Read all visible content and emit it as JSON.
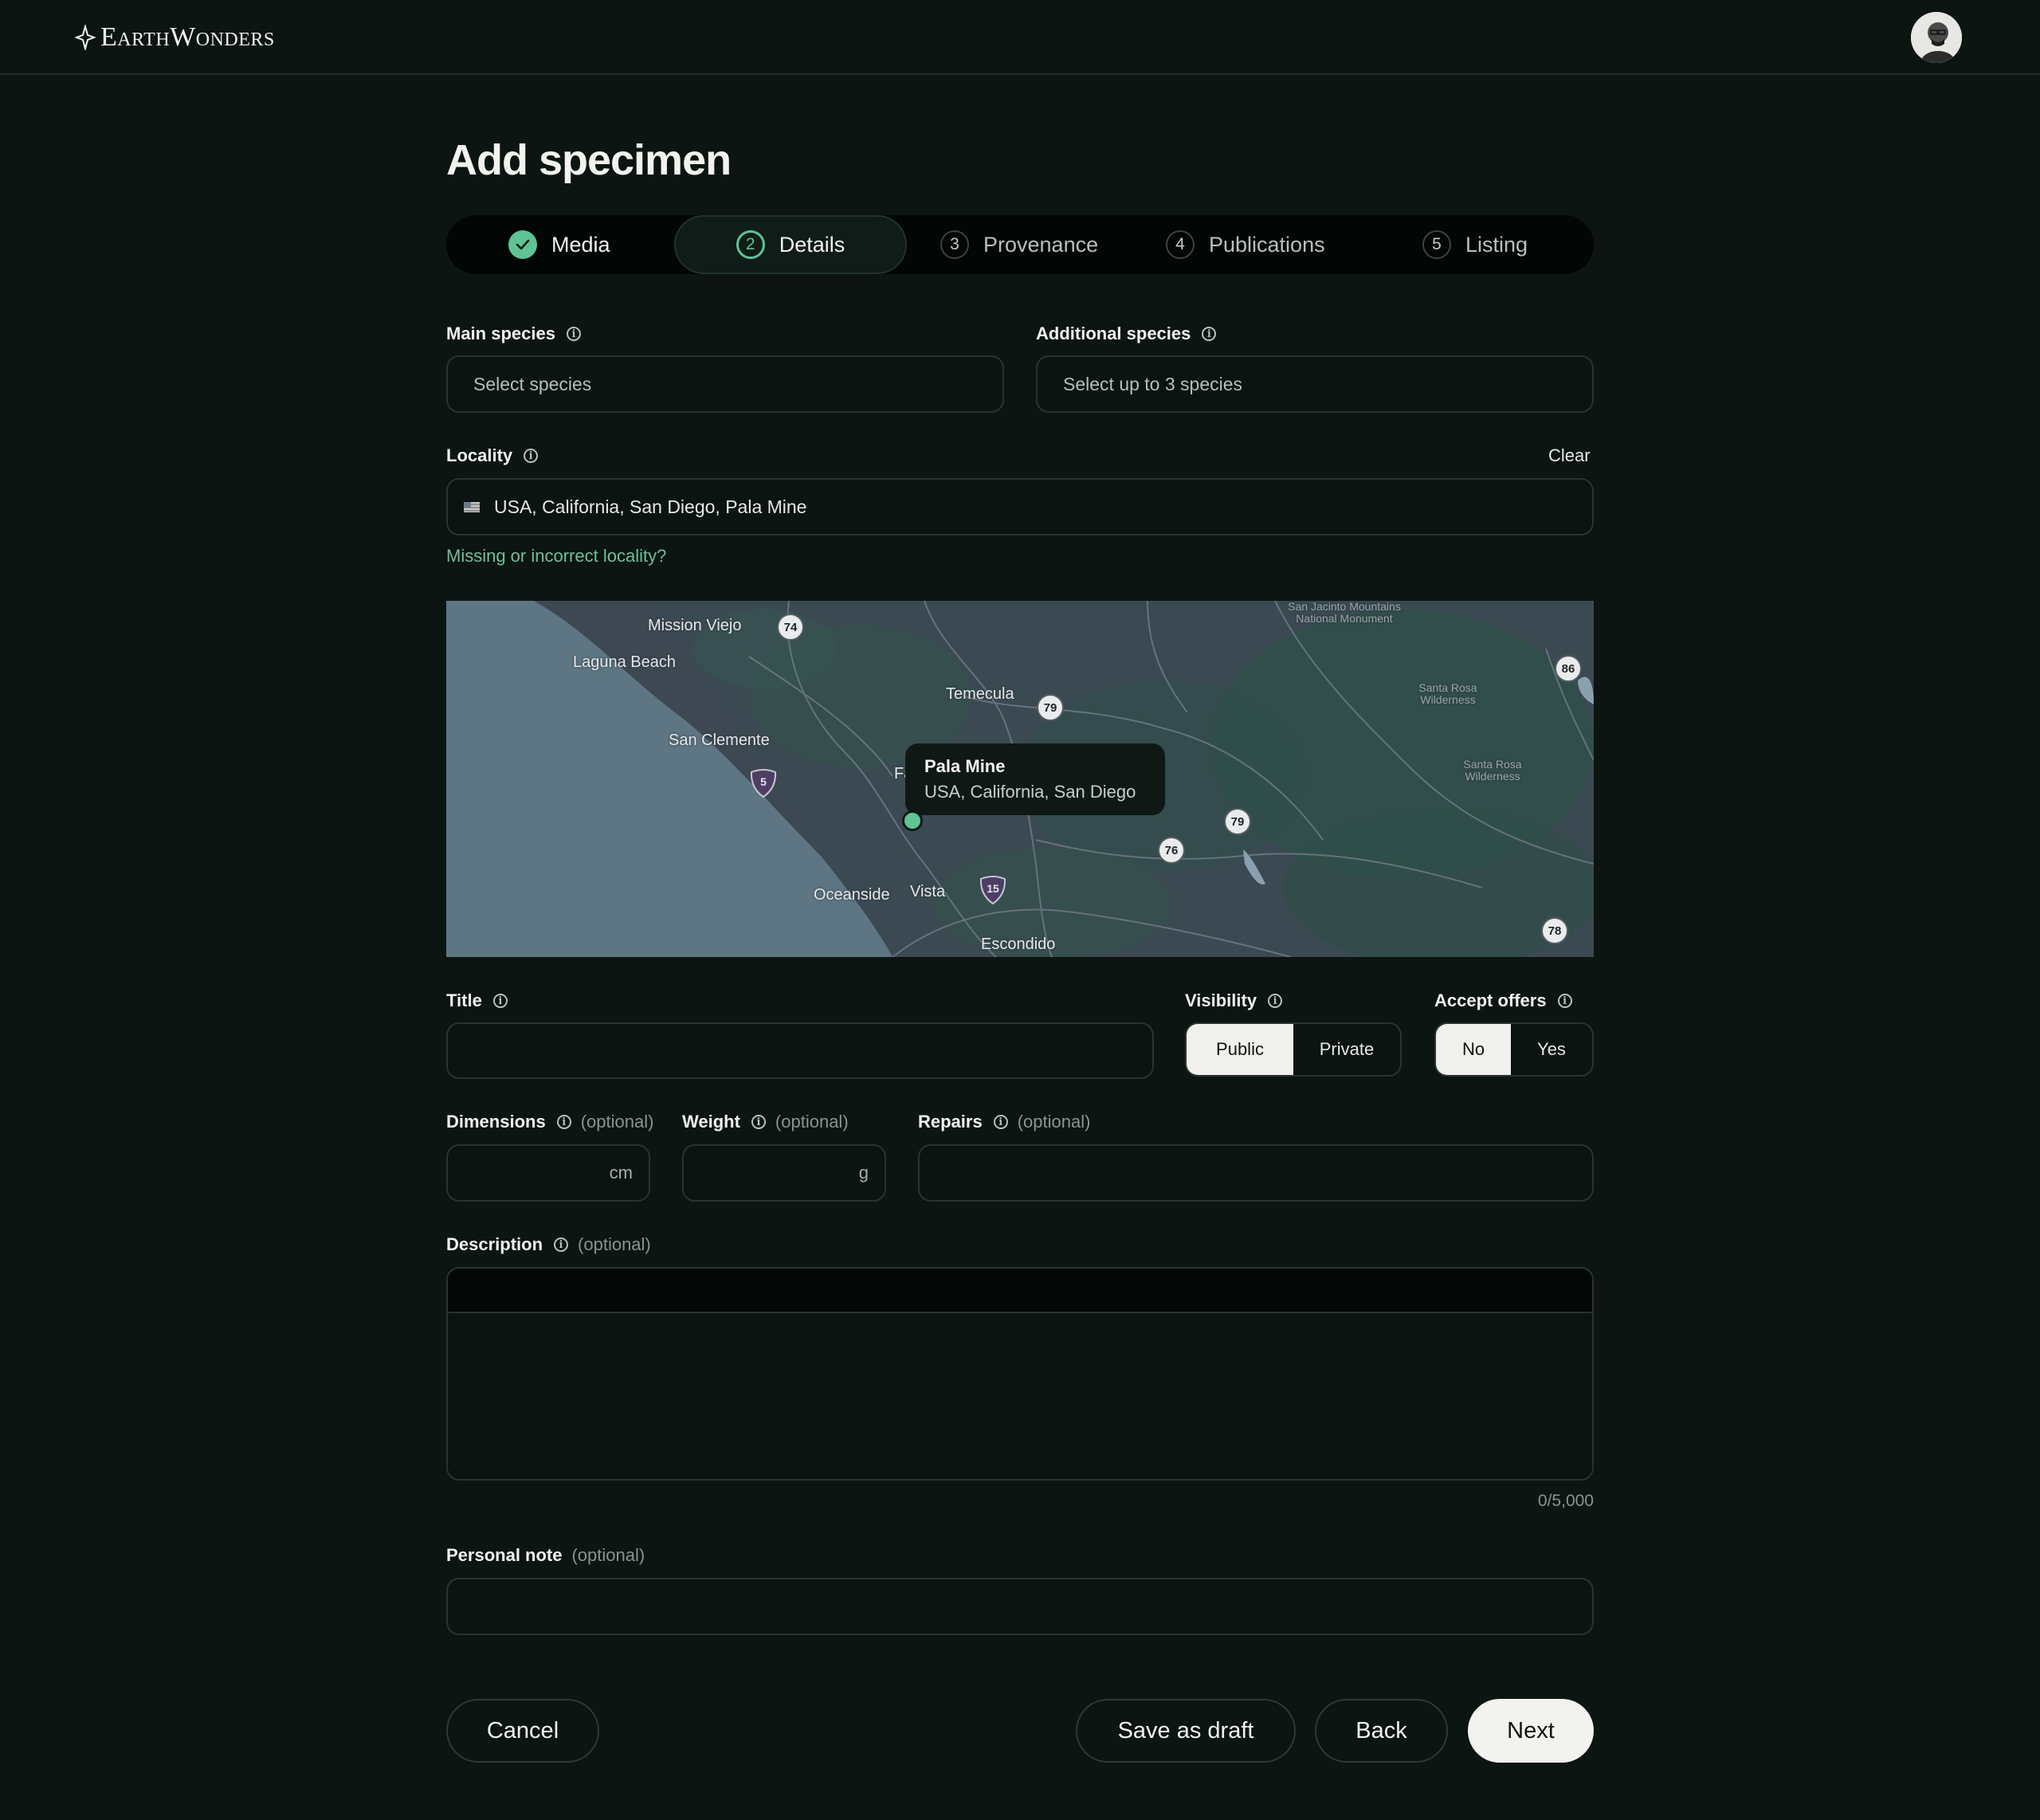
{
  "header": {
    "logo_text": "EarthWonders",
    "avatar_alt": "User avatar"
  },
  "page": {
    "title": "Add specimen"
  },
  "stepper": {
    "steps": [
      {
        "number": "",
        "label": "Media",
        "state": "done"
      },
      {
        "number": "2",
        "label": "Details",
        "state": "active"
      },
      {
        "number": "3",
        "label": "Provenance",
        "state": "upcoming"
      },
      {
        "number": "4",
        "label": "Publications",
        "state": "upcoming"
      },
      {
        "number": "5",
        "label": "Listing",
        "state": "upcoming"
      }
    ]
  },
  "form": {
    "main_species": {
      "label": "Main species",
      "placeholder": "Select species"
    },
    "additional_species": {
      "label": "Additional species",
      "placeholder": "Select up to 3 species"
    },
    "locality": {
      "label": "Locality",
      "clear": "Clear",
      "value": "USA, California, San Diego, Pala Mine",
      "missing_link": "Missing or incorrect locality?"
    },
    "title": {
      "label": "Title",
      "value": ""
    },
    "visibility": {
      "label": "Visibility",
      "options": [
        "Public",
        "Private"
      ],
      "selected": "Public"
    },
    "accept_offers": {
      "label": "Accept offers",
      "options": [
        "No",
        "Yes"
      ],
      "selected": "No"
    },
    "dimensions": {
      "label": "Dimensions",
      "optional": "(optional)",
      "unit": "cm"
    },
    "weight": {
      "label": "Weight",
      "optional": "(optional)",
      "unit": "g"
    },
    "repairs": {
      "label": "Repairs",
      "optional": "(optional)"
    },
    "description": {
      "label": "Description",
      "optional": "(optional)",
      "counter": "0/5,000"
    },
    "personal_note": {
      "label": "Personal note",
      "optional": "(optional)"
    }
  },
  "map": {
    "places": [
      "Mission Viejo",
      "Laguna Beach",
      "Temecula",
      "San Clemente",
      "Oceanside",
      "Vista",
      "Escondido",
      "Fa"
    ],
    "small_labels": [
      "San Jacinto Mountains National Monument",
      "Santa Rosa Wilderness",
      "Santa Rosa Wilderness"
    ],
    "highways": [
      "74",
      "79",
      "86",
      "79",
      "76",
      "78"
    ],
    "interstates": [
      "5",
      "15"
    ],
    "tooltip": {
      "title": "Pala Mine",
      "subtitle": "USA, California, San Diego"
    }
  },
  "actions": {
    "cancel": "Cancel",
    "save_draft": "Save as draft",
    "back": "Back",
    "next": "Next"
  },
  "colors": {
    "accent": "#5fc394",
    "background": "#0c1512",
    "button_light": "#f2f2ee"
  }
}
